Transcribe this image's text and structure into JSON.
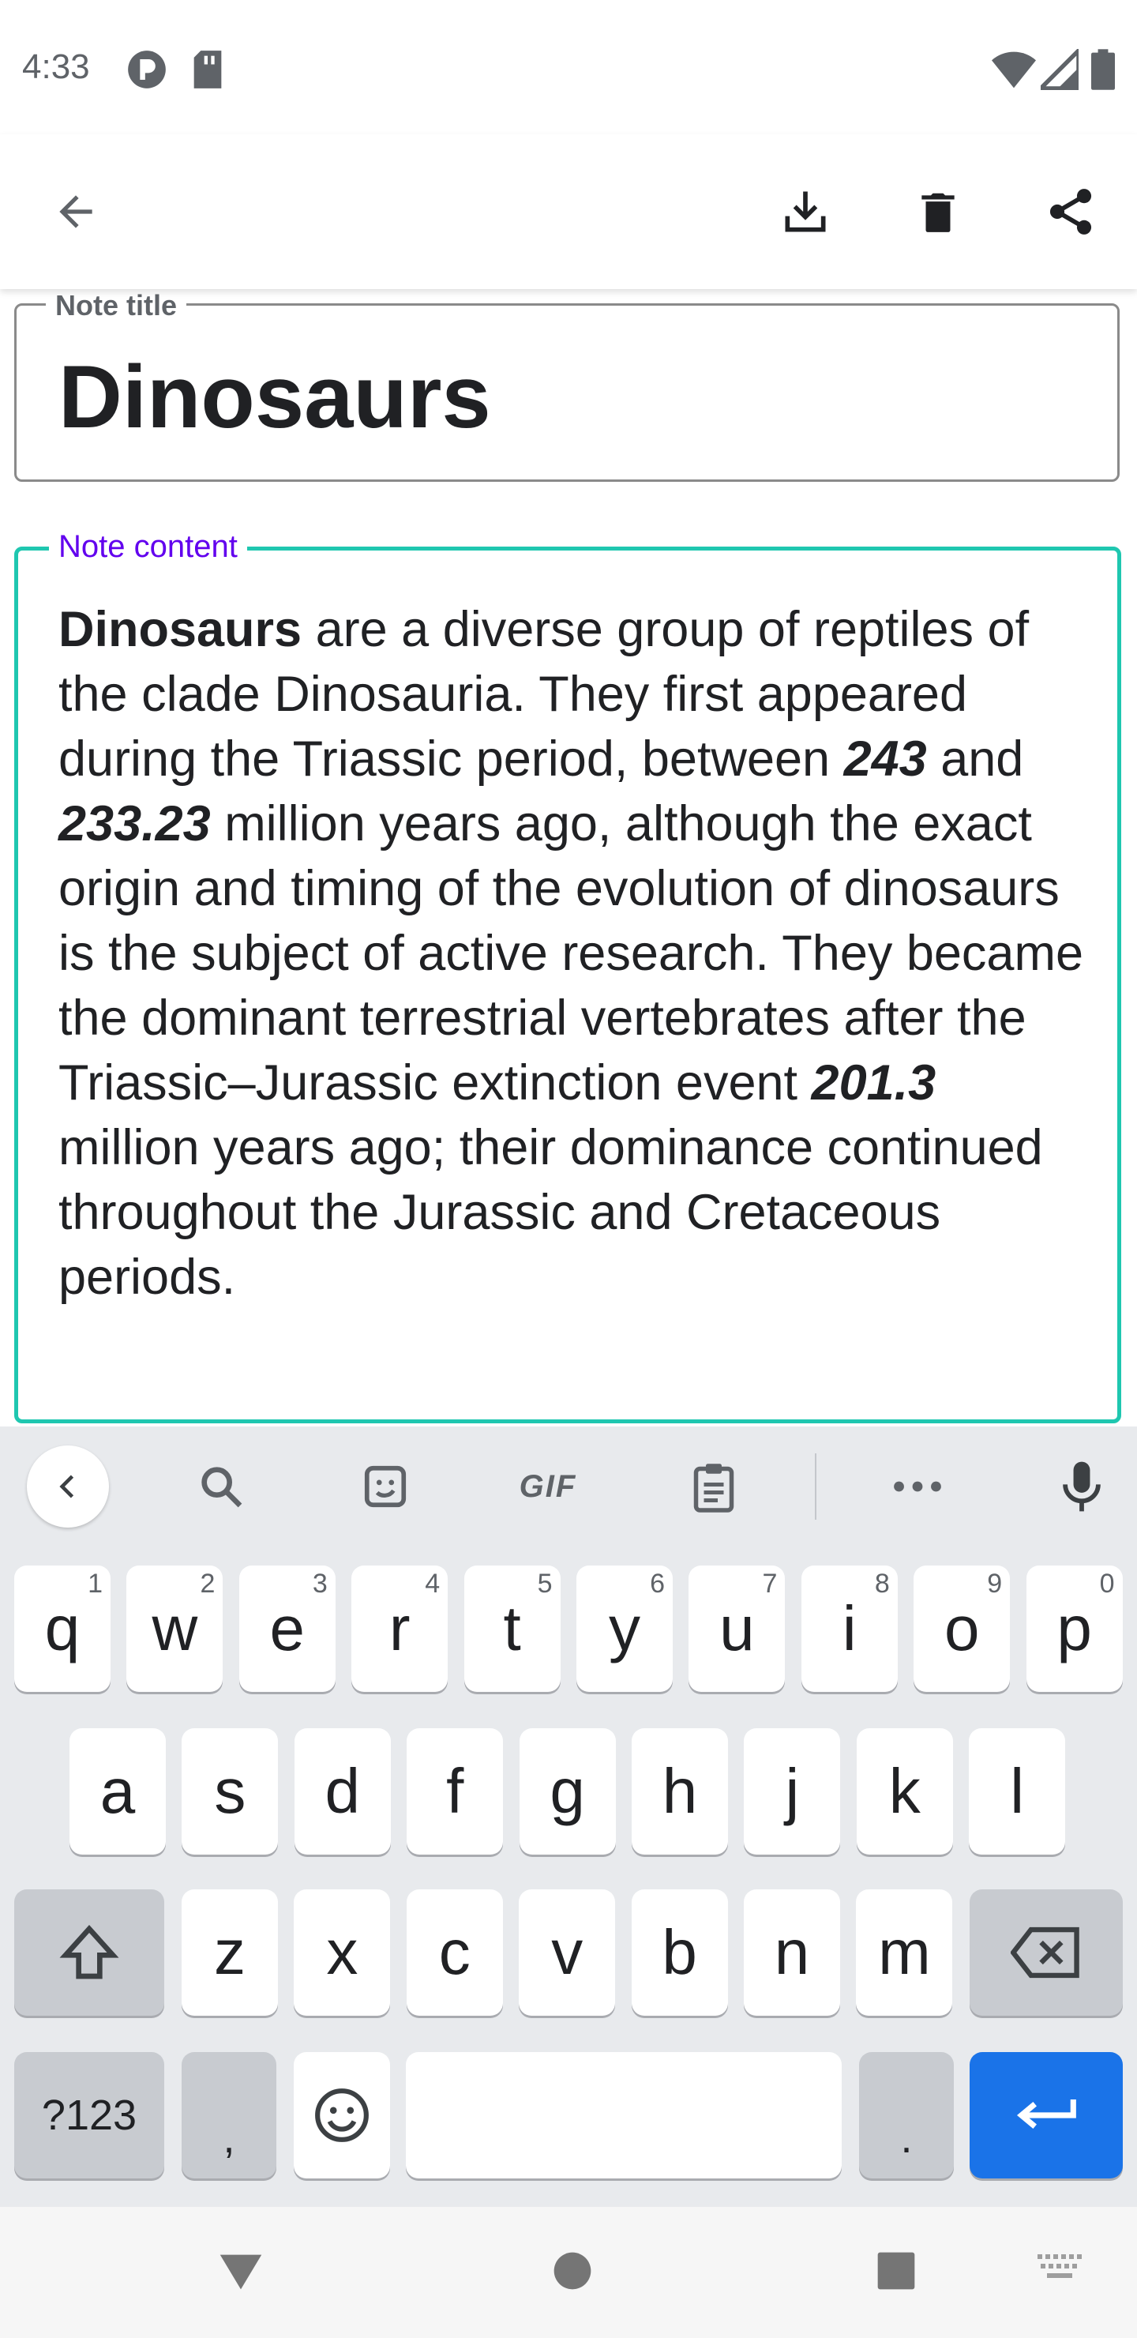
{
  "status_bar": {
    "time": "4:33"
  },
  "app_bar": {
    "back_icon": "arrow-back-icon",
    "actions": [
      "download-icon",
      "delete-icon",
      "share-icon"
    ]
  },
  "note": {
    "title_label": "Note title",
    "title": "Dinosaurs",
    "content_label": "Note content",
    "content": {
      "p1_bold": "Dinosaurs",
      "p2": " are a diverse group of reptiles of the clade Dinosauria. They first appeared during the Triassic period, between ",
      "n1": "243",
      "p3": " and ",
      "n2": "233.23",
      "p4": " million years ago, although the exact origin and timing of the evolution of dinosaurs is the subject of active research. They became the dominant terrestrial vertebrates after the Triassic–Jurassic extinction event ",
      "n3": "201.3",
      "p5": " million years ago; their dominance continued throughout the Jurassic and Cretaceous periods."
    }
  },
  "keyboard": {
    "toolbar": {
      "gif": "GIF"
    },
    "row1": [
      {
        "k": "q",
        "h": "1"
      },
      {
        "k": "w",
        "h": "2"
      },
      {
        "k": "e",
        "h": "3"
      },
      {
        "k": "r",
        "h": "4"
      },
      {
        "k": "t",
        "h": "5"
      },
      {
        "k": "y",
        "h": "6"
      },
      {
        "k": "u",
        "h": "7"
      },
      {
        "k": "i",
        "h": "8"
      },
      {
        "k": "o",
        "h": "9"
      },
      {
        "k": "p",
        "h": "0"
      }
    ],
    "row2": [
      "a",
      "s",
      "d",
      "f",
      "g",
      "h",
      "j",
      "k",
      "l"
    ],
    "row3": [
      "z",
      "x",
      "c",
      "v",
      "b",
      "n",
      "m"
    ],
    "symbols": "?123",
    "comma": ",",
    "period": "."
  },
  "colors": {
    "accent_teal": "#1fc7b0",
    "label_purple": "#6200ee",
    "enter_blue": "#1a73e8"
  }
}
